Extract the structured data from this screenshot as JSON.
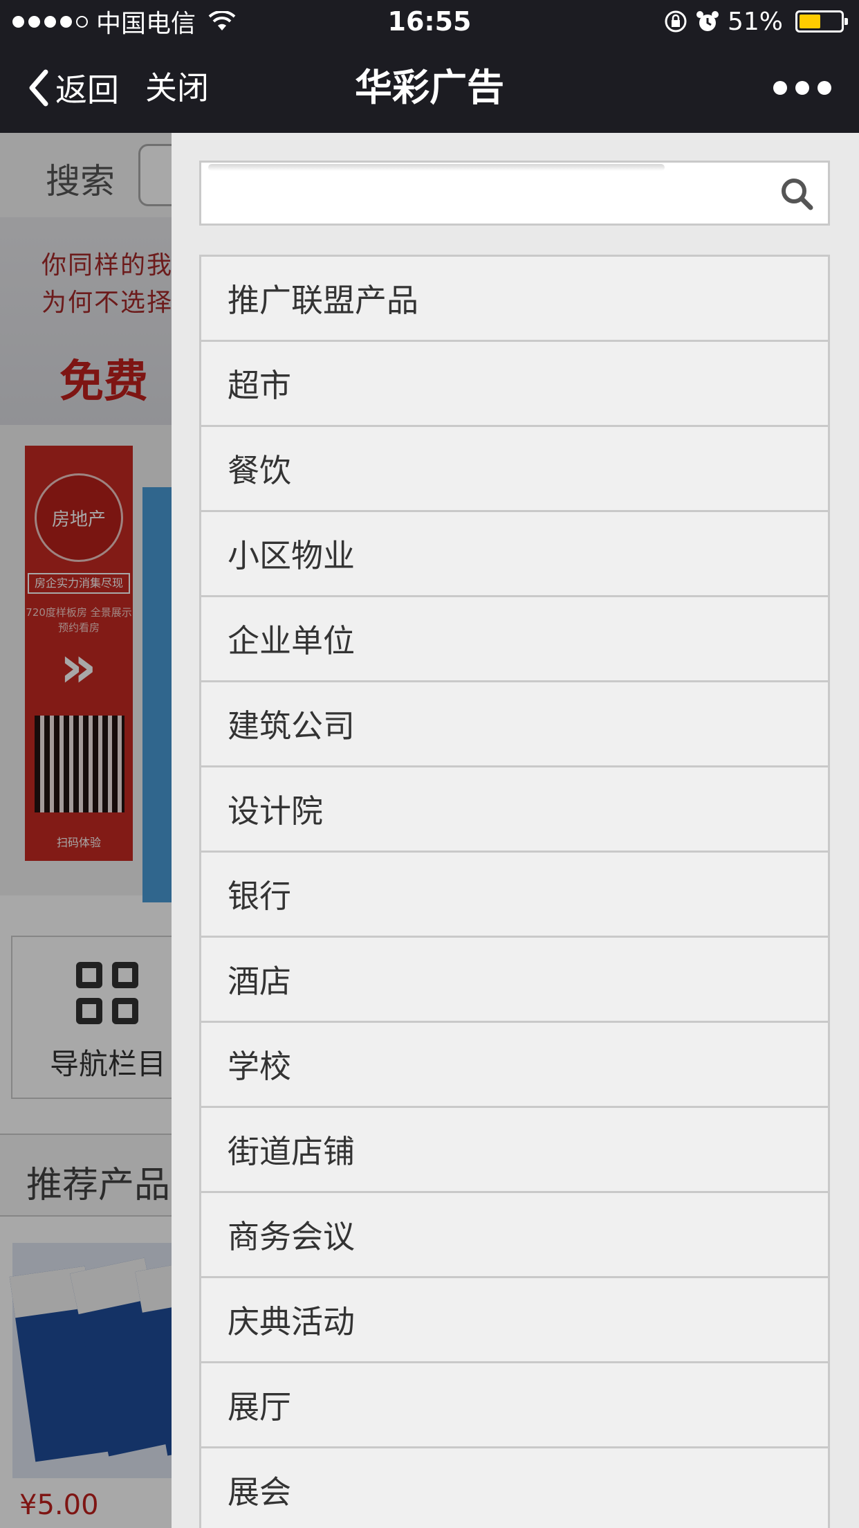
{
  "status_bar": {
    "carrier": "中国电信",
    "time": "16:55",
    "battery": "51%",
    "battery_level": 0.51,
    "battery_color": "#ffcc00"
  },
  "nav": {
    "back_label": "返回",
    "close_label": "关闭",
    "title": "华彩广告"
  },
  "background": {
    "search_label": "搜索",
    "banner_line1": "你同样的我",
    "banner_line2": "为何不选择",
    "banner_big": "免费",
    "poster_circle": "房地产",
    "poster_tag": "房企实力消集尽现",
    "poster_desc": "720度样板房 全景展示 预约看房",
    "poster_scan": "扫码体验",
    "nav_card_label": "导航栏目",
    "recommend_label": "推荐产品",
    "price": "¥5.00"
  },
  "drawer": {
    "search_value": "",
    "items": [
      {
        "label": "推广联盟产品"
      },
      {
        "label": "超市"
      },
      {
        "label": "餐饮"
      },
      {
        "label": "小区物业"
      },
      {
        "label": "企业单位"
      },
      {
        "label": "建筑公司"
      },
      {
        "label": "设计院"
      },
      {
        "label": "银行"
      },
      {
        "label": "酒店"
      },
      {
        "label": "学校"
      },
      {
        "label": "街道店铺"
      },
      {
        "label": "商务会议"
      },
      {
        "label": "庆典活动"
      },
      {
        "label": "展厅"
      },
      {
        "label": "展会"
      }
    ]
  }
}
